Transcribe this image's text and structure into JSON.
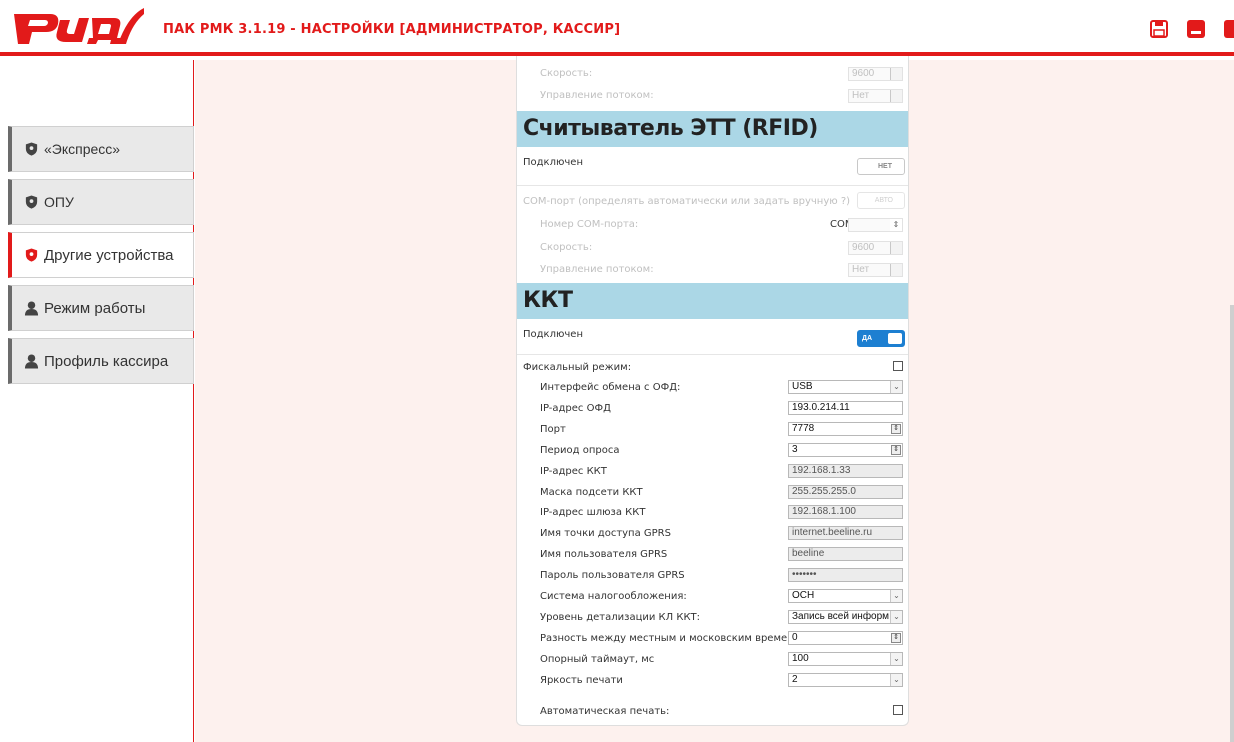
{
  "app": {
    "title": "ПАК РМК 3.1.19 - НАСТРОЙКИ [АДМИНИСТРАТОР, КАССИР]",
    "brand_color": "#e21a1a",
    "logo_icon": "rzd-logo"
  },
  "window_buttons": [
    "save-icon",
    "minimize-icon",
    "close-icon"
  ],
  "sidebar": {
    "items": [
      {
        "label": "«Экспресс»",
        "icon": "shield-icon",
        "active": false
      },
      {
        "label": "ОПУ",
        "icon": "shield-icon",
        "active": false
      },
      {
        "label": "Другие устройства",
        "icon": "shield-icon",
        "active": true
      },
      {
        "label": "Режим работы",
        "icon": "user-icon",
        "active": false
      },
      {
        "label": "Профиль кассира",
        "icon": "user-icon",
        "active": false
      }
    ]
  },
  "top_partial": {
    "speed_label": "Скорость:",
    "speed_value": "9600",
    "flow_label": "Управление потоком:",
    "flow_value": "Нет"
  },
  "rfid": {
    "title": "Считыватель ЭТТ (RFID)",
    "connected_label": "Подключен",
    "connected_value": "НЕТ",
    "com_auto_label": "COM-порт (определять автоматически или задать вручную ?)",
    "com_auto_value": "АВТО",
    "com_number_label": "Номер COM-порта:",
    "com_prefix": "COM",
    "speed_label": "Скорость:",
    "speed_value": "9600",
    "flow_label": "Управление потоком:",
    "flow_value": "Нет"
  },
  "kkt": {
    "title": "ККТ",
    "connected_label": "Подключен",
    "connected_value": "ДА",
    "fiscal_label": "Фискальный режим:",
    "fiscal_checked": false,
    "fields": [
      {
        "label": "Интерфейс обмена с ОФД:",
        "value": "USB",
        "kind": "select"
      },
      {
        "label": "IP-адрес ОФД",
        "value": "193.0.214.11",
        "kind": "input"
      },
      {
        "label": "Порт",
        "value": "7778",
        "kind": "spin"
      },
      {
        "label": "Период опроса",
        "value": "3",
        "kind": "spin"
      },
      {
        "label": "IP-адрес ККТ",
        "value": "192.168.1.33",
        "kind": "readonly"
      },
      {
        "label": "Маска подсети ККТ",
        "value": "255.255.255.0",
        "kind": "readonly"
      },
      {
        "label": "IP-адрес шлюза ККТ",
        "value": "192.168.1.100",
        "kind": "readonly"
      },
      {
        "label": "Имя точки доступа GPRS",
        "value": "internet.beeline.ru",
        "kind": "readonly"
      },
      {
        "label": "Имя пользователя GPRS",
        "value": "beeline",
        "kind": "readonly"
      },
      {
        "label": "Пароль пользователя GPRS",
        "value": "•••••••",
        "kind": "readonly"
      },
      {
        "label": "Система налогообложения:",
        "value": "ОСН",
        "kind": "select"
      },
      {
        "label": "Уровень детализации КЛ ККТ:",
        "value": "Запись всей информ",
        "kind": "select"
      },
      {
        "label": "Разность между местным и московским временем (ч)",
        "value": "0",
        "kind": "spin"
      },
      {
        "label": "Опорный таймаут, мс",
        "value": "100",
        "kind": "select"
      },
      {
        "label": "Яркость печати",
        "value": "2",
        "kind": "select"
      }
    ],
    "autoprint_label": "Автоматическая печать:",
    "autoprint_checked": false
  }
}
